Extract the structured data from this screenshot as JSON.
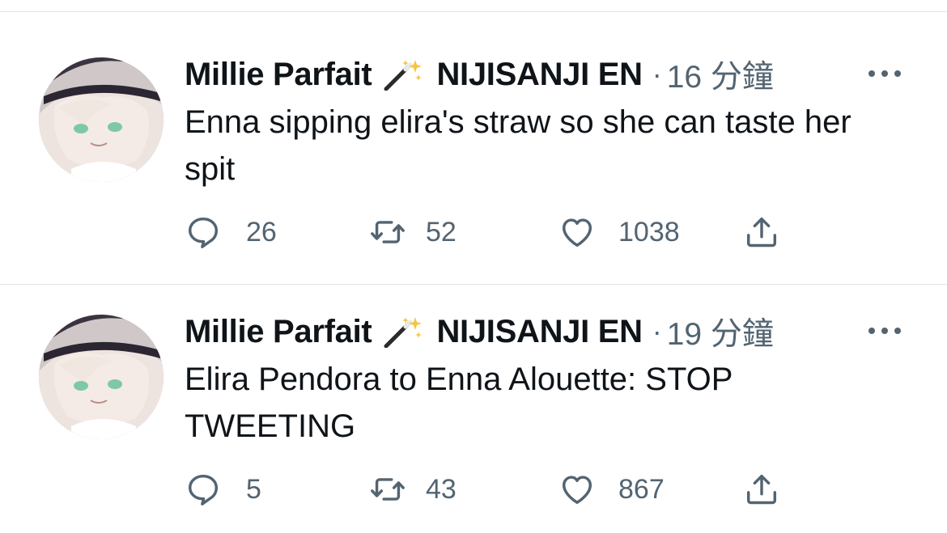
{
  "tweets": [
    {
      "author_name": "Millie Parfait",
      "badge_icon": "magic-wand-sparkles-icon",
      "org_name": "NIJISANJI EN",
      "separator": "·",
      "time_ago": "16 分鐘",
      "text": "Enna sipping elira's straw so she can taste her spit",
      "replies": "26",
      "retweets": "52",
      "likes": "1038"
    },
    {
      "author_name": "Millie Parfait",
      "badge_icon": "magic-wand-sparkles-icon",
      "org_name": "NIJISANJI EN",
      "separator": "·",
      "time_ago": "19 分鐘",
      "text": "Elira Pendora to Enna Alouette: STOP TWEETING",
      "replies": "5",
      "retweets": "43",
      "likes": "867"
    }
  ],
  "colors": {
    "text_primary": "#0f1419",
    "text_secondary": "#536471",
    "divider": "#e1e6ea"
  }
}
